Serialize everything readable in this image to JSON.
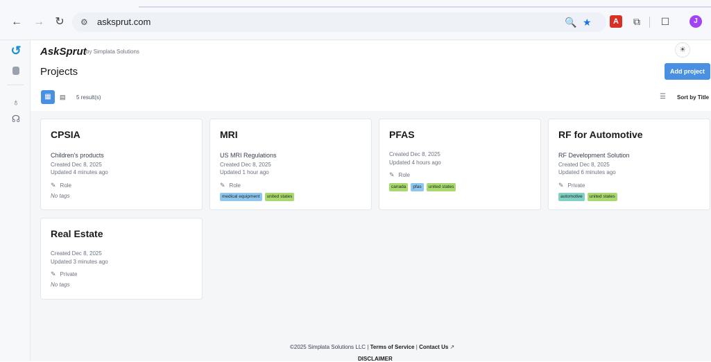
{
  "browser": {
    "url": "asksprut.com",
    "profile_initial": "J"
  },
  "header": {
    "brand": "AskSprut",
    "brand_by": "by Simplata Solutions",
    "page_title": "Projects",
    "add_button": "Add project"
  },
  "toolbar": {
    "results": "5 result(s)",
    "sort_label": "Sort by Title"
  },
  "projects": [
    {
      "title": "CPSIA",
      "description": "Children's products",
      "created": "Created Dec 8, 2025",
      "updated": "Updated 4 minutes ago",
      "role": "Role",
      "no_tags": "No tags",
      "tags": []
    },
    {
      "title": "MRI",
      "description": "US MRI Regulations",
      "created": "Created Dec 8, 2025",
      "updated": "Updated 1 hour ago",
      "role": "Role",
      "tags": [
        "medical equipment",
        "united states"
      ]
    },
    {
      "title": "PFAS",
      "description": "",
      "created": "Created Dec 8, 2025",
      "updated": "Updated 4 hours ago",
      "role": "Role",
      "tags": [
        "canada",
        "pfas",
        "united states"
      ]
    },
    {
      "title": "RF for Automotive",
      "description": "RF Development Solution",
      "created": "Created Dec 8, 2025",
      "updated": "Updated 6 minutes ago",
      "role": "Private",
      "tags": [
        "automotive",
        "united states"
      ]
    },
    {
      "title": "Real Estate",
      "description": "",
      "created": "Created Dec 8, 2025",
      "updated": "Updated 3 minutes ago",
      "role": "Private",
      "no_tags": "No tags",
      "tags": []
    }
  ],
  "footer": {
    "copyright": "©2025 Simplata Solutions LLC",
    "separator": "|",
    "terms": "Terms of Service",
    "contact": "Contact Us",
    "disclaimer": "DISCLAIMER"
  },
  "colors": {
    "accent": "#4a90e2",
    "tag_green": "#a9d86e",
    "tag_blue": "#8fc6ee",
    "tag_teal": "#7fd1c3"
  }
}
